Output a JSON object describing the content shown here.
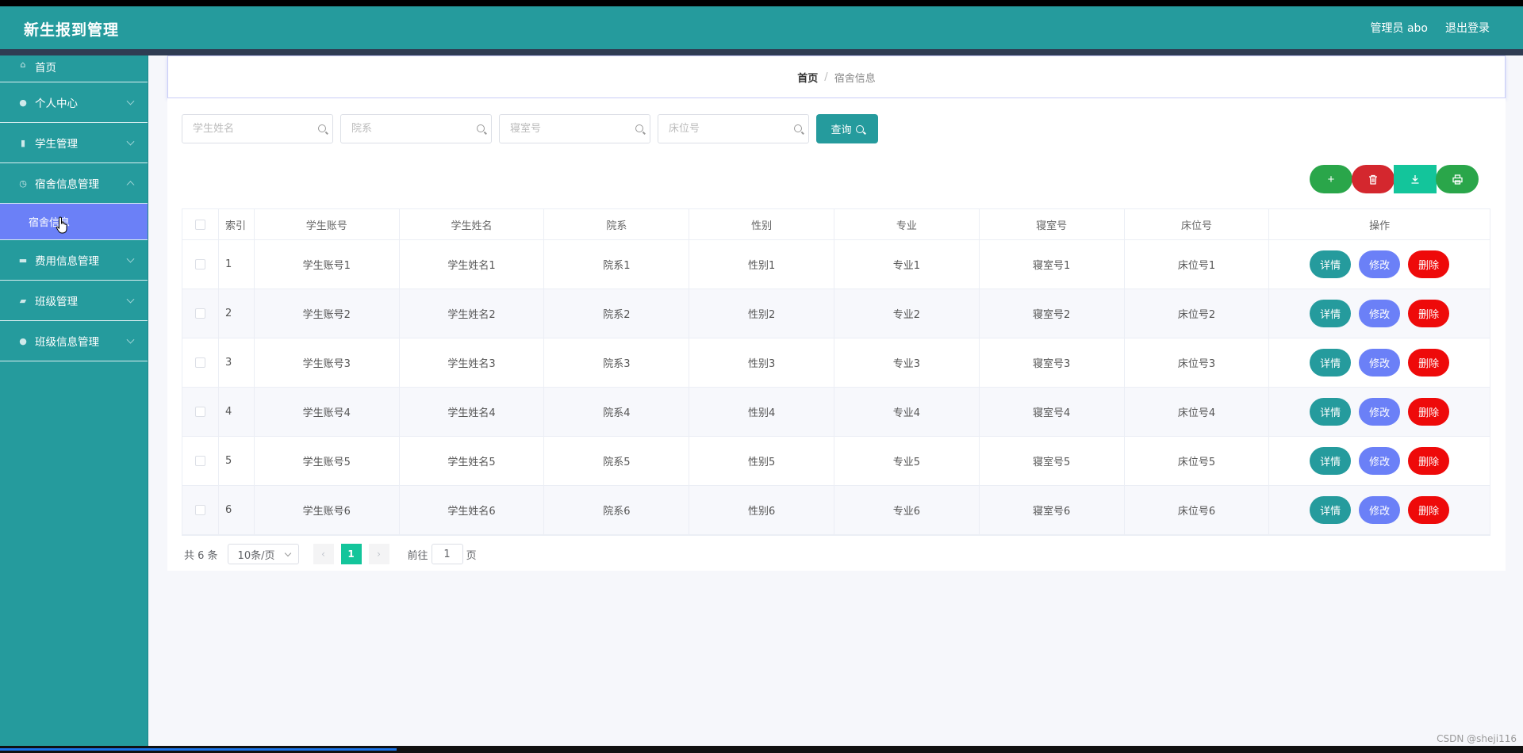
{
  "header": {
    "title": "新生报到管理",
    "user": "管理员 abo",
    "logout": "退出登录"
  },
  "sidebar": {
    "items": [
      {
        "label": "首页",
        "icon": "home-icon"
      },
      {
        "label": "个人中心",
        "icon": "user-icon"
      },
      {
        "label": "学生管理",
        "icon": "student-icon"
      },
      {
        "label": "宿舍信息管理",
        "icon": "dorm-icon"
      },
      {
        "label": "费用信息管理",
        "icon": "fee-icon"
      },
      {
        "label": "班级管理",
        "icon": "class-icon"
      },
      {
        "label": "班级信息管理",
        "icon": "class-info-icon"
      }
    ],
    "submenu": {
      "label": "宿舍信息"
    }
  },
  "breadcrumb": {
    "home": "首页",
    "separator": "/",
    "current": "宿舍信息"
  },
  "search": {
    "student_name": "学生姓名",
    "department": "院系",
    "dorm_no": "寝室号",
    "bed_no": "床位号",
    "query_label": "查询"
  },
  "table": {
    "headers": [
      "索引",
      "学生账号",
      "学生姓名",
      "院系",
      "性别",
      "专业",
      "寝室号",
      "床位号",
      "操作"
    ],
    "rows": [
      {
        "idx": "1",
        "account": "学生账号1",
        "name": "学生姓名1",
        "dept": "院系1",
        "gender": "性别1",
        "major": "专业1",
        "dorm": "寝室号1",
        "bed": "床位号1"
      },
      {
        "idx": "2",
        "account": "学生账号2",
        "name": "学生姓名2",
        "dept": "院系2",
        "gender": "性别2",
        "major": "专业2",
        "dorm": "寝室号2",
        "bed": "床位号2"
      },
      {
        "idx": "3",
        "account": "学生账号3",
        "name": "学生姓名3",
        "dept": "院系3",
        "gender": "性别3",
        "major": "专业3",
        "dorm": "寝室号3",
        "bed": "床位号3"
      },
      {
        "idx": "4",
        "account": "学生账号4",
        "name": "学生姓名4",
        "dept": "院系4",
        "gender": "性别4",
        "major": "专业4",
        "dorm": "寝室号4",
        "bed": "床位号4"
      },
      {
        "idx": "5",
        "account": "学生账号5",
        "name": "学生姓名5",
        "dept": "院系5",
        "gender": "性别5",
        "major": "专业5",
        "dorm": "寝室号5",
        "bed": "床位号5"
      },
      {
        "idx": "6",
        "account": "学生账号6",
        "name": "学生姓名6",
        "dept": "院系6",
        "gender": "性别6",
        "major": "专业6",
        "dorm": "寝室号6",
        "bed": "床位号6"
      }
    ],
    "ops": {
      "detail": "详情",
      "edit": "修改",
      "delete": "删除"
    }
  },
  "pagination": {
    "total": "共 6 条",
    "page_size": "10条/页",
    "current_page": "1",
    "goto_prefix": "前往",
    "goto_value": "1",
    "goto_suffix": "页"
  },
  "watermark": "CSDN @sheji116",
  "colors": {
    "primary": "#259b9d",
    "accent": "#6b80f7",
    "danger": "#ee0a0a",
    "success": "#2aa64a",
    "export": "#13c59b"
  }
}
